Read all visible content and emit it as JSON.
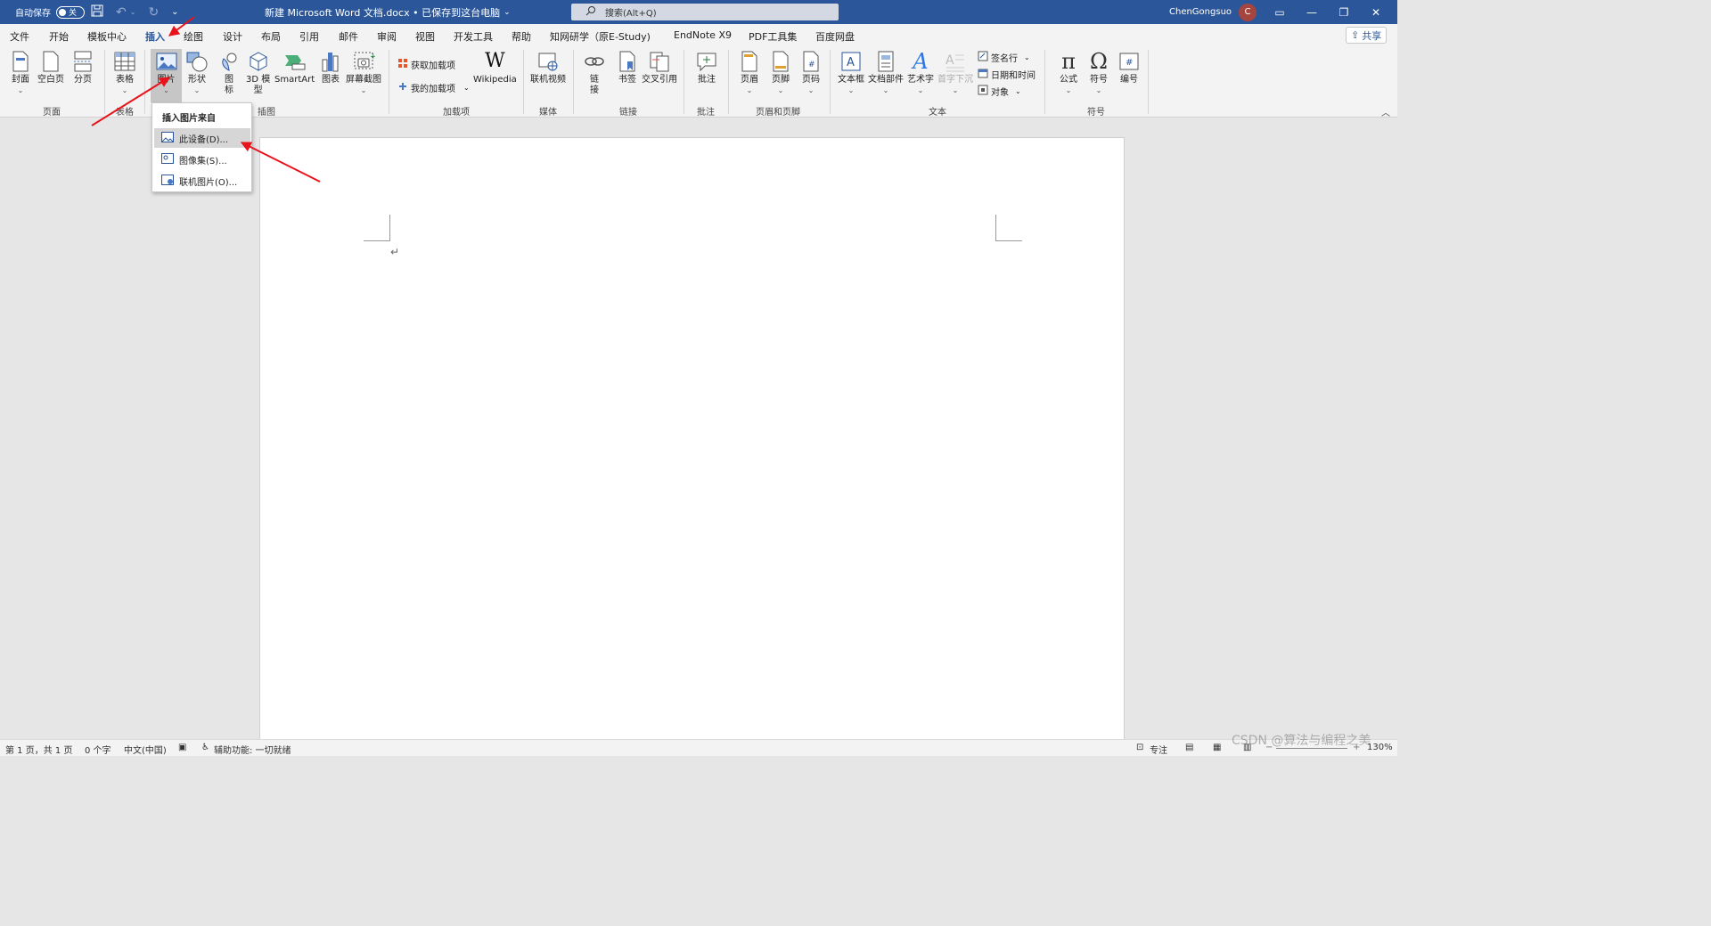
{
  "titlebar": {
    "autosave_label": "自动保存",
    "autosave_state": "关",
    "doc_title": "新建 Microsoft Word 文档.docx • 已保存到这台电脑",
    "search_placeholder": "搜索(Alt+Q)",
    "user_name": "ChenGongsuo",
    "user_initial": "C"
  },
  "menu": {
    "tabs": [
      "文件",
      "开始",
      "模板中心",
      "插入",
      "绘图",
      "设计",
      "布局",
      "引用",
      "邮件",
      "审阅",
      "视图",
      "开发工具",
      "帮助",
      "知网研学（原E-Study)",
      "EndNote X9",
      "PDF工具集",
      "百度网盘"
    ],
    "active_tab": "插入",
    "share_label": "共享"
  },
  "ribbon": {
    "groups": {
      "pages": "页面",
      "tables": "表格",
      "illustrations": "插图",
      "addins": "加载项",
      "media": "媒体",
      "links": "链接",
      "comments": "批注",
      "header_footer": "页眉和页脚",
      "text": "文本",
      "symbols": "符号"
    },
    "buttons": {
      "cover": "封面",
      "blank_page": "空白页",
      "page_break": "分页",
      "table": "表格",
      "picture": "图片",
      "shapes": "形状",
      "icons_1": "图",
      "icons_2": "标",
      "model_3d_1": "3D 模",
      "model_3d_2": "型",
      "smartart": "SmartArt",
      "chart": "图表",
      "screenshot": "屏幕截图",
      "get_addins": "获取加载项",
      "my_addins": "我的加载项",
      "wikipedia": "Wikipedia",
      "online_video": "联机视频",
      "link_1": "链",
      "link_2": "接",
      "bookmark": "书签",
      "cross_ref": "交叉引用",
      "comment": "批注",
      "header": "页眉",
      "footer": "页脚",
      "page_number": "页码",
      "text_box": "文本框",
      "quick_parts": "文档部件",
      "wordart": "艺术字",
      "drop_cap": "首字下沉",
      "signature_line": "签名行",
      "date_time": "日期和时间",
      "object": "对象",
      "equation": "公式",
      "symbol": "符号",
      "numbering": "编号"
    }
  },
  "picture_dropdown": {
    "header": "插入图片来自",
    "items": [
      "此设备(D)...",
      "图像集(S)...",
      "联机图片(O)..."
    ]
  },
  "document": {
    "paragraph_mark": "↵"
  },
  "statusbar": {
    "page_info": "第 1 页，共 1 页",
    "word_count": "0 个字",
    "language": "中文(中国)",
    "accessibility": "辅助功能: 一切就绪",
    "focus": "专注",
    "zoom": "130%",
    "watermark": "CSDN @算法与编程之美"
  },
  "colors": {
    "accent": "#2b579a",
    "annotation_arrow": "#e8131b"
  }
}
